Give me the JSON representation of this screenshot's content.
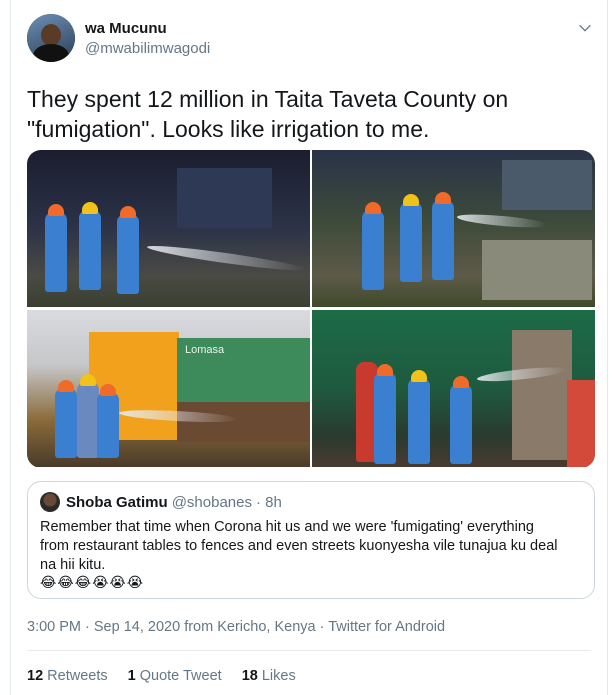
{
  "author": {
    "name": "wa Mucunu",
    "handle": "@mwabilimwagodi"
  },
  "tweet": {
    "text_line1": "They spent 12 million in Taita Taveta County on",
    "text_line2": "\"fumigation\". Looks like irrigation to me."
  },
  "media": {
    "photos": [
      {
        "description": "workers-spraying-at-night"
      },
      {
        "description": "workers-spraying-near-steps"
      },
      {
        "description": "workers-spraying-by-building"
      },
      {
        "description": "workers-spraying-street"
      }
    ],
    "building_sign": "Lomasa"
  },
  "quoted_tweet": {
    "name": "Shoba Gatimu",
    "handle": "@shobanes",
    "time": "· 8h",
    "text_line1": "Remember that time when Corona hit us and we were 'fumigating' everything",
    "text_line2": "from restaurant tables to fences and even streets kuonyesha vile tunajua ku deal",
    "text_line3": "na hii kitu.",
    "emojis": "😂😂😂😭😭😭"
  },
  "meta": {
    "time": "3:00 PM",
    "sep1": " · ",
    "date": "Sep 14, 2020",
    "from_label": " from ",
    "location": "Kericho, Kenya",
    "sep2": " · ",
    "source": "Twitter for Android"
  },
  "stats": {
    "retweets_count": "12",
    "retweets_label": "Retweets",
    "quotes_count": "1",
    "quotes_label": "Quote Tweet",
    "likes_count": "18",
    "likes_label": "Likes"
  },
  "colors": {
    "text_primary": "#14171a",
    "text_secondary": "#657786",
    "border": "#ccd6dd",
    "coverall_blue": "#3b7fd1",
    "helmet_orange": "#f06a2a",
    "helmet_yellow": "#f2c21b"
  },
  "icons": {
    "more": "chevron-down-icon"
  }
}
